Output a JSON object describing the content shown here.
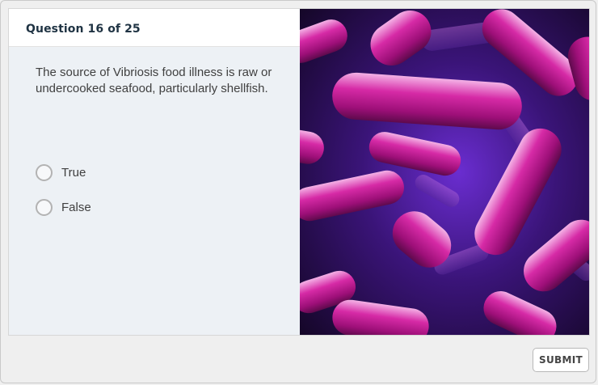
{
  "quiz": {
    "question_number": "Question 16 of 25",
    "prompt": "The source of Vibriosis food illness is raw or undercooked seafood, particularly shellfish.",
    "choices": [
      {
        "label": "True",
        "selected": false
      },
      {
        "label": "False",
        "selected": false
      }
    ],
    "submit_label": "SUBMIT"
  },
  "image": {
    "subject": "magenta rod-shaped bacteria on dark purple background",
    "colors": {
      "background": "#4a1a8a",
      "bacteria": "#c6148f",
      "highlight": "#f2a5df"
    }
  }
}
